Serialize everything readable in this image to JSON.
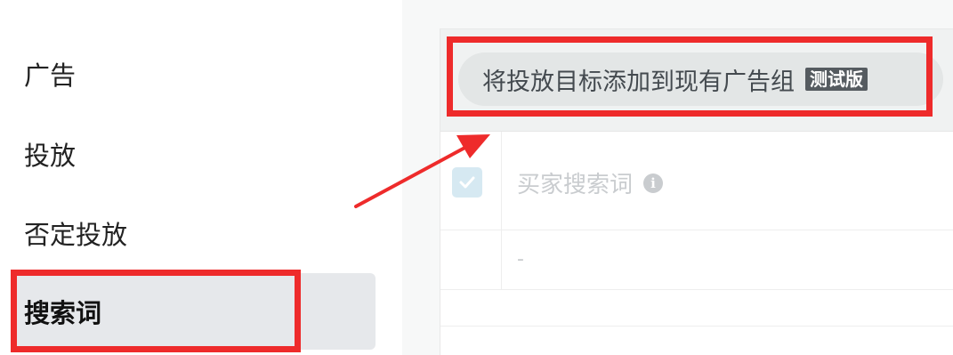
{
  "sidebar": {
    "items": [
      {
        "label": "广告"
      },
      {
        "label": "投放"
      },
      {
        "label": "否定投放"
      },
      {
        "label": "搜索词"
      }
    ]
  },
  "action_bar": {
    "add_button_label": "将投放目标添加到现有广告组",
    "beta_badge": "测试版"
  },
  "table": {
    "column_header": "买家搜索词",
    "rows": [
      {
        "search_term": "-"
      }
    ]
  },
  "colors": {
    "annotation_red": "#ee2b2b",
    "active_nav_bg": "#e6e8eb",
    "checkbox_bg": "#d6e9f2"
  },
  "icons": {
    "header_info": "info-icon",
    "header_checkbox": "checkbox-checked-icon"
  }
}
